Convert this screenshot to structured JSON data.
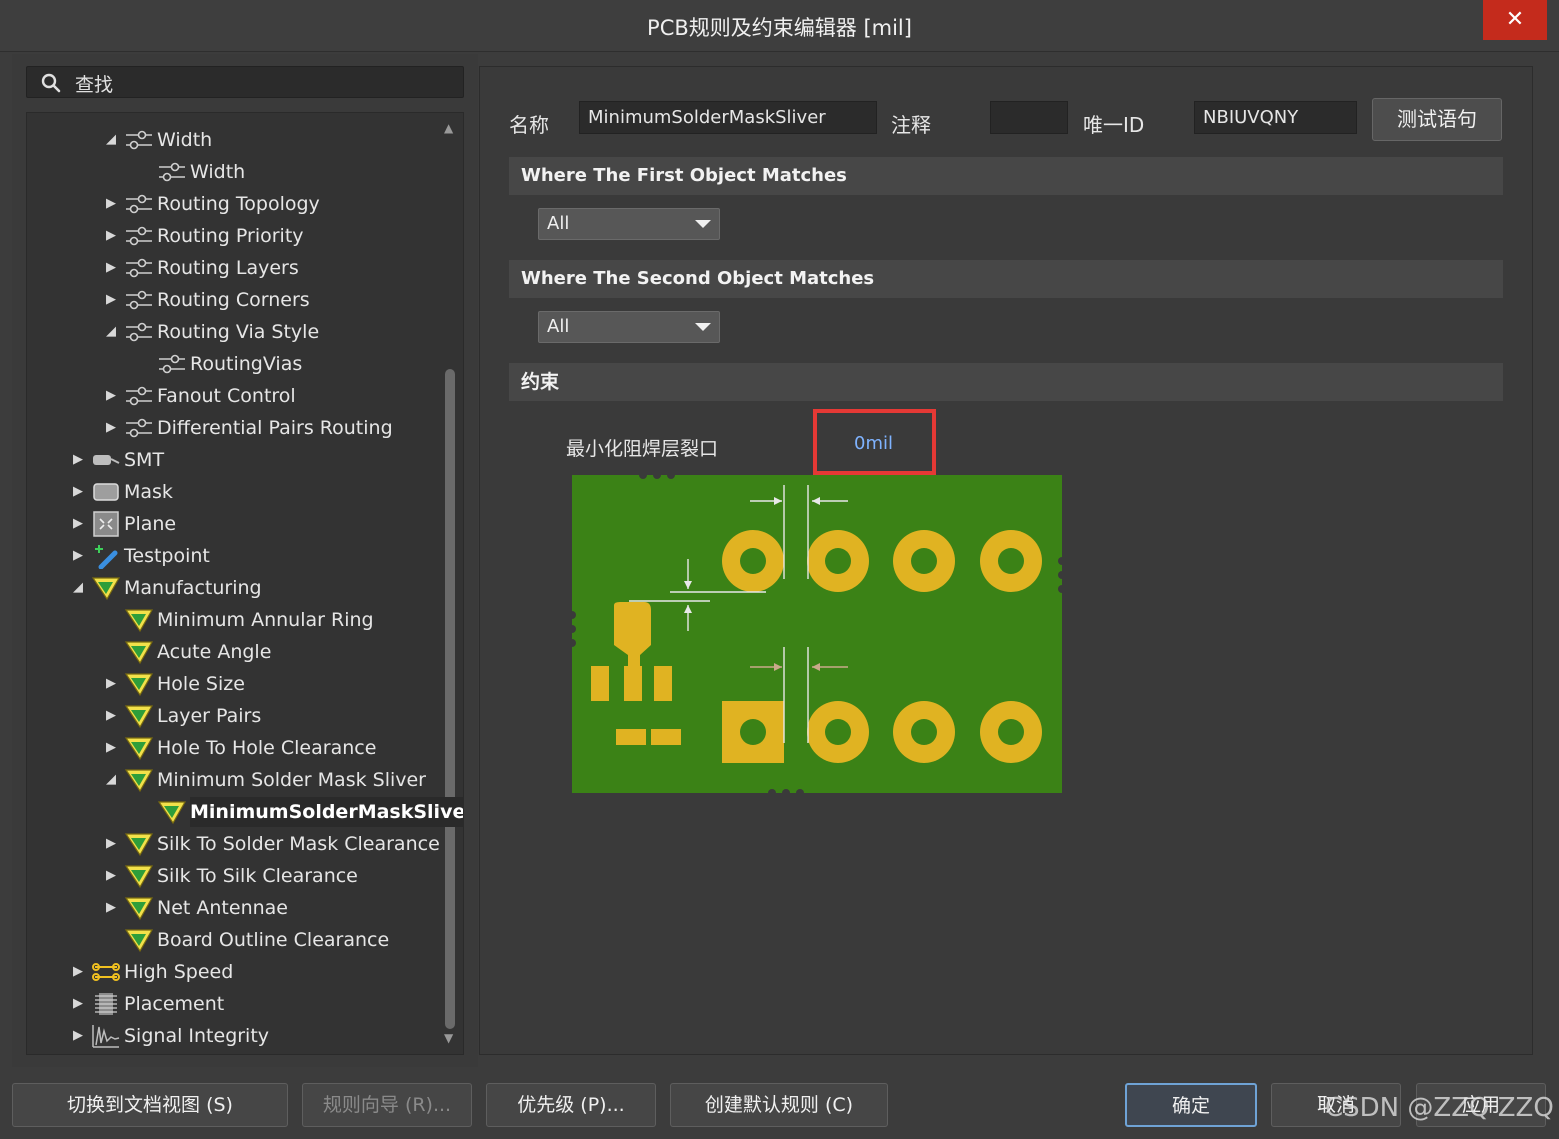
{
  "window": {
    "title": "PCB规则及约束编辑器 [mil]",
    "close_glyph": "✕"
  },
  "search": {
    "label": "查找"
  },
  "tree": [
    {
      "label": "Width",
      "level": 1,
      "arrow": "expanded",
      "icon": "routing-rule-icon"
    },
    {
      "label": "Width",
      "level": 2,
      "arrow": "none",
      "icon": "routing-rule-icon"
    },
    {
      "label": "Routing Topology",
      "level": 1,
      "arrow": "collapsed",
      "icon": "routing-rule-icon"
    },
    {
      "label": "Routing Priority",
      "level": 1,
      "arrow": "collapsed",
      "icon": "routing-rule-icon"
    },
    {
      "label": "Routing Layers",
      "level": 1,
      "arrow": "collapsed",
      "icon": "routing-rule-icon"
    },
    {
      "label": "Routing Corners",
      "level": 1,
      "arrow": "collapsed",
      "icon": "routing-rule-icon"
    },
    {
      "label": "Routing Via Style",
      "level": 1,
      "arrow": "expanded",
      "icon": "routing-rule-icon"
    },
    {
      "label": "RoutingVias",
      "level": 2,
      "arrow": "none",
      "icon": "routing-rule-icon"
    },
    {
      "label": "Fanout Control",
      "level": 1,
      "arrow": "collapsed",
      "icon": "routing-rule-icon"
    },
    {
      "label": "Differential Pairs Routing",
      "level": 1,
      "arrow": "collapsed",
      "icon": "routing-rule-icon"
    },
    {
      "label": "SMT",
      "level": 0,
      "arrow": "collapsed",
      "icon": "smt-icon"
    },
    {
      "label": "Mask",
      "level": 0,
      "arrow": "collapsed",
      "icon": "mask-icon"
    },
    {
      "label": "Plane",
      "level": 0,
      "arrow": "collapsed",
      "icon": "plane-icon"
    },
    {
      "label": "Testpoint",
      "level": 0,
      "arrow": "collapsed",
      "icon": "testpoint-icon"
    },
    {
      "label": "Manufacturing",
      "level": 0,
      "arrow": "expanded",
      "icon": "manufacturing-icon"
    },
    {
      "label": "Minimum Annular Ring",
      "level": 1,
      "arrow": "none",
      "icon": "manufacturing-icon"
    },
    {
      "label": "Acute Angle",
      "level": 1,
      "arrow": "none",
      "icon": "manufacturing-icon"
    },
    {
      "label": "Hole Size",
      "level": 1,
      "arrow": "collapsed",
      "icon": "manufacturing-icon"
    },
    {
      "label": "Layer Pairs",
      "level": 1,
      "arrow": "collapsed",
      "icon": "manufacturing-icon"
    },
    {
      "label": "Hole To Hole Clearance",
      "level": 1,
      "arrow": "collapsed",
      "icon": "manufacturing-icon"
    },
    {
      "label": "Minimum Solder Mask Sliver",
      "level": 1,
      "arrow": "expanded",
      "icon": "manufacturing-icon"
    },
    {
      "label": "MinimumSolderMaskSliver",
      "level": 2,
      "arrow": "none",
      "icon": "manufacturing-icon",
      "selected": true
    },
    {
      "label": "Silk To Solder Mask Clearance",
      "level": 1,
      "arrow": "collapsed",
      "icon": "manufacturing-icon"
    },
    {
      "label": "Silk To Silk Clearance",
      "level": 1,
      "arrow": "collapsed",
      "icon": "manufacturing-icon"
    },
    {
      "label": "Net Antennae",
      "level": 1,
      "arrow": "collapsed",
      "icon": "manufacturing-icon"
    },
    {
      "label": "Board Outline Clearance",
      "level": 1,
      "arrow": "none",
      "icon": "manufacturing-icon"
    },
    {
      "label": "High Speed",
      "level": 0,
      "arrow": "collapsed",
      "icon": "high-speed-icon"
    },
    {
      "label": "Placement",
      "level": 0,
      "arrow": "collapsed",
      "icon": "placement-icon"
    },
    {
      "label": "Signal Integrity",
      "level": 0,
      "arrow": "collapsed",
      "icon": "signal-integrity-icon"
    }
  ],
  "rule": {
    "name_label": "名称",
    "name_value": "MinimumSolderMaskSliver",
    "comment_label": "注释",
    "comment_value": "",
    "unique_id_label": "唯一ID",
    "unique_id_value": "NBIUVQNY",
    "test_button": "测试语句"
  },
  "first_match": {
    "header": "Where The First Object Matches",
    "value": "All"
  },
  "second_match": {
    "header": "Where The Second Object Matches",
    "value": "All"
  },
  "constraints": {
    "header": "约束",
    "label": "最小化阻焊层裂口",
    "value": "0mil"
  },
  "buttons": {
    "switch_view": "切换到文档视图 (S)",
    "rule_wizard": "规则向导 (R)...",
    "priority": "优先级 (P)...",
    "create_default": "创建默认规则 (C)",
    "ok": "确定",
    "cancel": "取消",
    "apply": "应用"
  },
  "watermark": "CSDN @ZZQ ZZQ",
  "colors": {
    "board_green": "#3b8216",
    "pad_gold": "#e0b322",
    "highlight_red": "#e53935",
    "value_blue": "#7fb3ff"
  }
}
